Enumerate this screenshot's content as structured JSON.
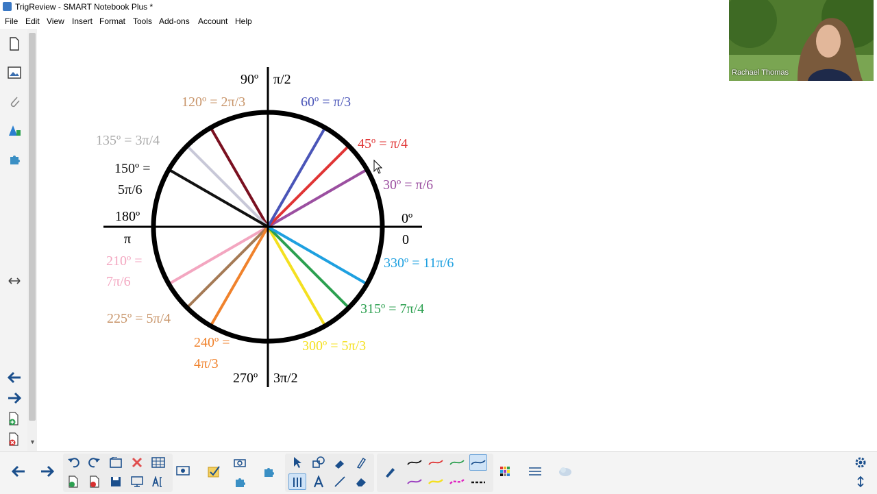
{
  "window": {
    "title": "TrigReview - SMART Notebook Plus *"
  },
  "menu": {
    "items": [
      "File",
      "Edit",
      "View",
      "Insert",
      "Format",
      "Tools",
      "Add-ons",
      "Account",
      "Help"
    ]
  },
  "webcam": {
    "name": "Rachael Thomas"
  },
  "diagram": {
    "axis_labels": {
      "top_deg": "90º",
      "top_rad": "π/2",
      "bottom_deg": "270º",
      "bottom_rad": "3π/2",
      "left_deg": "180º",
      "left_rad": "π",
      "right_deg": "0º",
      "right_rad": "0"
    },
    "angles": [
      {
        "degrees": 30,
        "label": "30º = π/6",
        "color": "#9b4fa0"
      },
      {
        "degrees": 45,
        "label": "45º = π/4",
        "color": "#e03434"
      },
      {
        "degrees": 60,
        "label": "60º = π/3",
        "color": "#4a55b8"
      },
      {
        "degrees": 120,
        "label": "120º = 2π/3",
        "color": "#7a1020"
      },
      {
        "degrees": 135,
        "label": "135º = 3π/4",
        "color": "#c8c8d8"
      },
      {
        "degrees": 150,
        "label_lines": [
          "150º =",
          "5π/6"
        ],
        "color": "#111111"
      },
      {
        "degrees": 210,
        "label_lines": [
          "210º =",
          "7π/6"
        ],
        "color": "#f3a6c0"
      },
      {
        "degrees": 225,
        "label": "225º = 5π/4",
        "color": "#a57a55"
      },
      {
        "degrees": 240,
        "label_lines": [
          "240º =",
          "4π/3"
        ],
        "color": "#f0822c"
      },
      {
        "degrees": 300,
        "label": "300º = 5π/3",
        "color": "#f4e020"
      },
      {
        "degrees": 315,
        "label": "315º = 7π/4",
        "color": "#2ca050"
      },
      {
        "degrees": 330,
        "label": "330º = 11π/6",
        "color": "#1ea0e0"
      }
    ],
    "label_colors": {
      "30": "#9b4fa0",
      "45": "#e03434",
      "60": "#4a55b8",
      "120": "#c8956a",
      "135": "#a8a8a8",
      "150": "#111111",
      "210": "#f3a6c0",
      "225": "#c8956a",
      "240": "#f0822c",
      "300": "#f4e020",
      "315": "#2ca050",
      "330": "#1ea0e0"
    }
  },
  "toolbar": {
    "icons": [
      "back-arrow-icon",
      "forward-arrow-icon",
      "undo-icon",
      "redo-icon",
      "open-file-icon",
      "delete-icon",
      "table-icon",
      "add-page-icon",
      "delete-page-icon",
      "save-icon",
      "screen-shade-icon",
      "text-recognition-icon",
      "screen-capture-icon",
      "response-icon",
      "camera-icon",
      "addon-icon",
      "select-icon",
      "shapes-icon",
      "fill-icon",
      "text-tool-icon",
      "line-tool-icon",
      "eraser-icon",
      "pen-icon",
      "color-grid-icon",
      "properties-icon",
      "cloud-icon",
      "settings-icon"
    ]
  }
}
